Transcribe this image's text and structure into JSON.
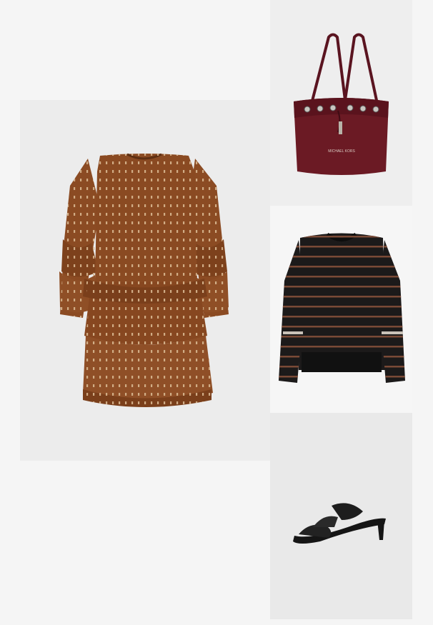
{
  "products": [
    {
      "id": "dress",
      "name": "dress-image",
      "color": "#8a4a22"
    },
    {
      "id": "bag",
      "name": "bag-image",
      "color": "#6b1a24"
    },
    {
      "id": "sweater",
      "name": "sweater-image",
      "color": "#1c1a1a"
    },
    {
      "id": "shoe",
      "name": "sandal-image",
      "color": "#151515"
    }
  ],
  "bag": {
    "logo_text": "MICHAEL KORS"
  }
}
